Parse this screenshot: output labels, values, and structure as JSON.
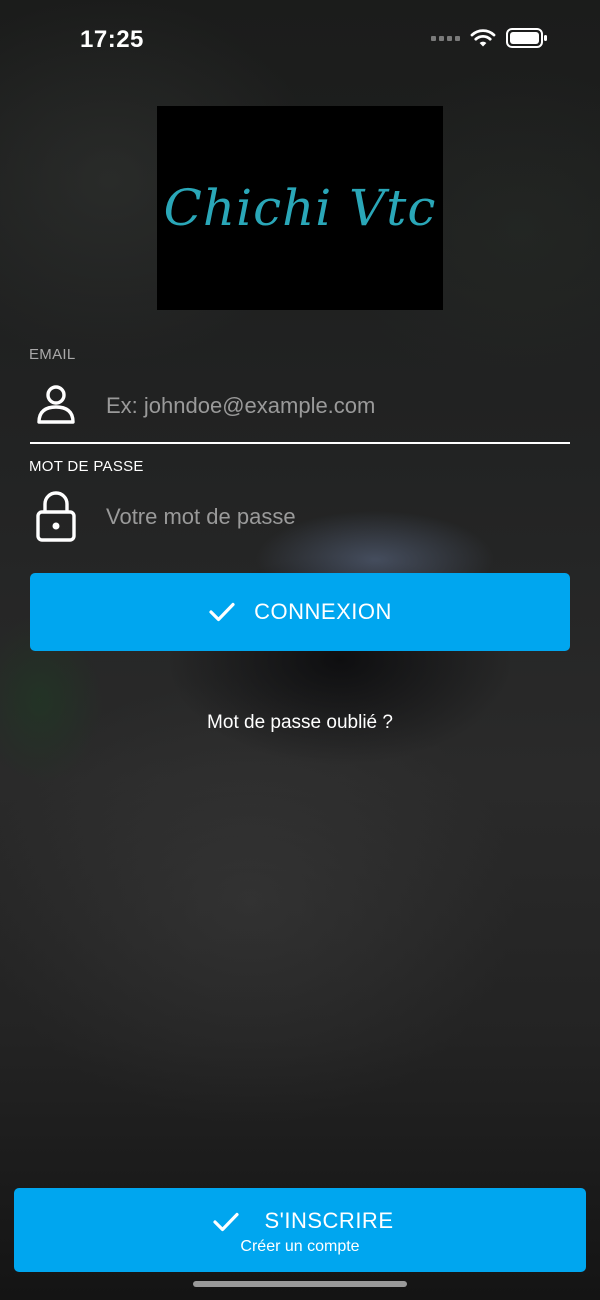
{
  "status_bar": {
    "time": "17:25",
    "icons": [
      "signal-icon",
      "wifi-icon",
      "battery-icon"
    ]
  },
  "logo": {
    "text": "Chichi Vtc",
    "color": "#2aa7b8"
  },
  "form": {
    "email": {
      "label": "EMAIL",
      "placeholder": "Ex: johndoe@example.com",
      "value": "",
      "icon": "user-icon"
    },
    "password": {
      "label": "MOT DE PASSE",
      "placeholder": "Votre mot de passe",
      "value": "",
      "icon": "lock-icon"
    },
    "login_button": {
      "label": "CONNEXION",
      "icon": "check-icon"
    },
    "forgot_link": "Mot de passe oublié ?"
  },
  "signup_button": {
    "title": "S'INSCRIRE",
    "subtitle": "Créer un compte",
    "icon": "check-icon"
  },
  "colors": {
    "accent": "#00a6ef",
    "logo": "#2aa7b8"
  }
}
